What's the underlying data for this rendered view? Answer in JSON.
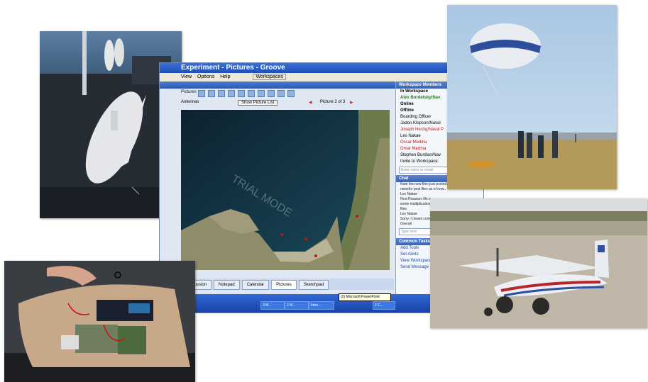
{
  "window": {
    "title": "Experiment - Pictures - Groove",
    "menu": [
      "View",
      "Options",
      "Help"
    ],
    "workspaces_label": "Workspaces",
    "toolbar_label": "Pictures",
    "picture_name": "Antennas",
    "show_picture_list": "Show Picture List",
    "picture_counter": "Picture 2 of 3",
    "map_watermark": "TRIAL MODE"
  },
  "tabs": [
    {
      "label": "Discussion",
      "active": false
    },
    {
      "label": "Notepad",
      "active": false
    },
    {
      "label": "Calendar",
      "active": false
    },
    {
      "label": "Pictures",
      "active": true
    },
    {
      "label": "Sketchpad",
      "active": false
    }
  ],
  "tooltip": "(2) Microsoft PowerPoint",
  "taskbar_items": [
    "3 M...",
    "2 M...",
    "Inbo...",
    "2 C..."
  ],
  "side_panel": {
    "members_header": "Workspace Members",
    "in_workspace": "In Workspace",
    "in_workspace_members": [
      "Alex Bordetsky/Nav"
    ],
    "online": "Online",
    "offline": "Offline",
    "offline_members": [
      {
        "name": "Boarding Officer",
        "color": "black"
      },
      {
        "name": "Jadon Klopson/Naval",
        "color": "black"
      },
      {
        "name": "Joseph Herzig/Naval P",
        "color": "red"
      },
      {
        "name": "Les Nakae",
        "color": "black"
      },
      {
        "name": "Oscar Medina",
        "color": "red"
      },
      {
        "name": "Omar Medina",
        "color": "red"
      },
      {
        "name": "Stephen Burdian/Nav",
        "color": "black"
      }
    ],
    "invite_label": "Invite to Workspace:",
    "invite_placeholder": "Enter name or email",
    "chat_header": "Chat",
    "chat_lines": [
      "Note the new files just posted. Most are",
      "newsfor post files as of now...",
      "Les Nakae",
      "First Rosanov file is",
      "some multiplication",
      "files",
      "Les Nakae",
      "Sorry, I meant com",
      "Overall"
    ],
    "type_here": "Type here",
    "tasks_header": "Common Tasks",
    "tasks": [
      "Add Tools",
      "Set Alerts",
      "View Workspace",
      "Send Message"
    ]
  },
  "colors": {
    "titlebar": "#1d4fb7",
    "taskbar": "#1941a5",
    "online_member": "#237a1f",
    "offline_highlight": "#d01010"
  }
}
